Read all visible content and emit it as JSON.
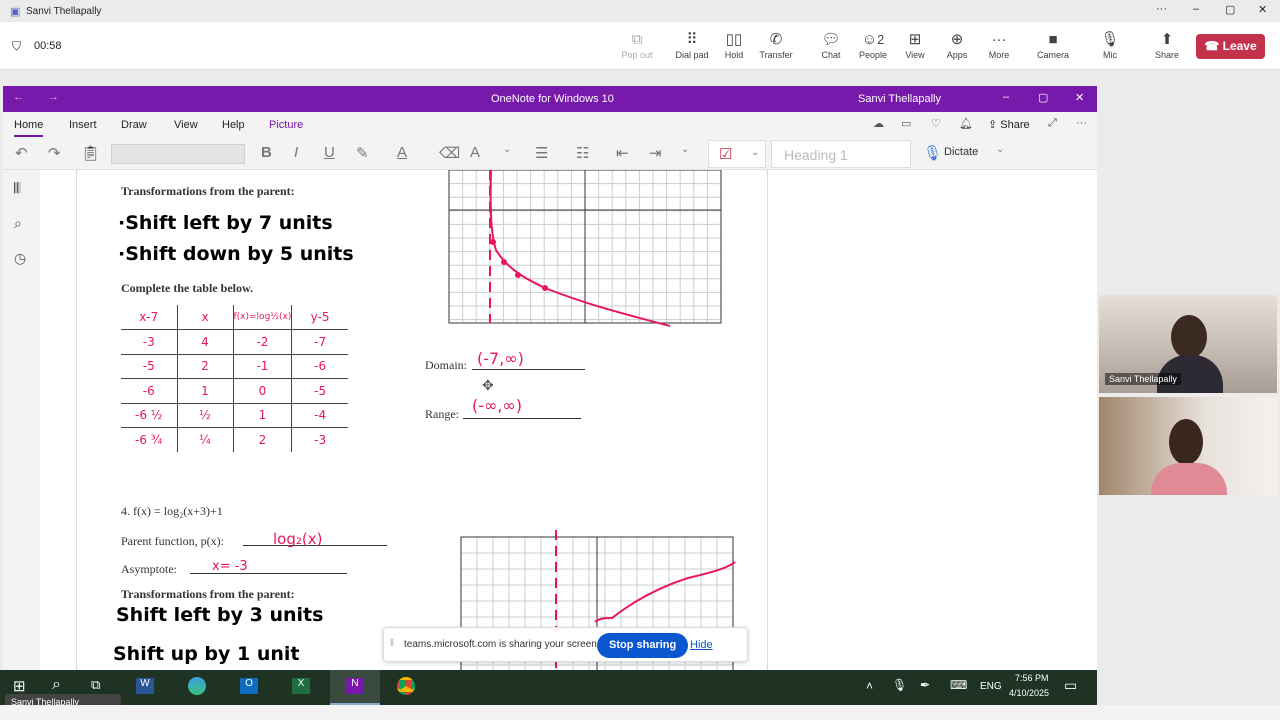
{
  "teams": {
    "app_title": "Sanvi Thellapally",
    "timer": "00:58",
    "buttons": [
      {
        "label": "Pop out",
        "icon": "pop-out-icon"
      },
      {
        "label": "Dial pad",
        "icon": "dial-pad-icon"
      },
      {
        "label": "Hold",
        "icon": "hold-icon"
      },
      {
        "label": "Transfer",
        "icon": "transfer-icon"
      },
      {
        "label": "Chat",
        "icon": "chat-icon"
      },
      {
        "label": "People",
        "icon": "people-icon",
        "badge": "2"
      },
      {
        "label": "View",
        "icon": "view-icon"
      },
      {
        "label": "Apps",
        "icon": "apps-icon"
      },
      {
        "label": "More",
        "icon": "more-icon"
      },
      {
        "label": "Camera",
        "icon": "camera-icon"
      },
      {
        "label": "Mic",
        "icon": "mic-icon"
      },
      {
        "label": "Share",
        "icon": "share-icon"
      }
    ],
    "leave": "Leave",
    "leave_color": "#c4314b",
    "participants": [
      {
        "name": "Sanvi Thellapally"
      },
      {
        "name": ""
      }
    ]
  },
  "onenote": {
    "title": "OneNote for Windows 10",
    "user": "Sanvi Thellapally",
    "accent": "#7719aa",
    "tabs": [
      "Home",
      "Insert",
      "Draw",
      "View",
      "Help",
      "Picture"
    ],
    "active_tab": "Home",
    "share": "Share",
    "style": "Heading 1",
    "dictate": "Dictate"
  },
  "page": {
    "transform_heading": "Transformations from the parent:",
    "p3_transforms": [
      "·Shift left by 7 units",
      "·Shift down by 5 units"
    ],
    "table_heading": "Complete the table below.",
    "table_headers": [
      "x-7",
      "x",
      "f(x)=log½(x)",
      "y-5"
    ],
    "table_rows": [
      [
        "-3",
        "4",
        "-2",
        "-7"
      ],
      [
        "-5",
        "2",
        "-1",
        "-6"
      ],
      [
        "-6",
        "1",
        "0",
        "-5"
      ],
      [
        "-6 ½",
        "½",
        "1",
        "-4"
      ],
      [
        "-6 ¾",
        "¼",
        "2",
        "-3"
      ]
    ],
    "domain_label": "Domain:",
    "domain_value": "(-7,∞)",
    "range_label": "Range:",
    "range_value": "(-∞,∞)",
    "p4_title": "4.  f(x) = log₂(x+3)+1",
    "parent_label": "Parent function, p(x):",
    "parent_value": "log₂(x)",
    "asymptote_label": "Asymptote:",
    "asymptote_value": "x= -3",
    "p4_transforms": [
      "Shift left by 3 units",
      "Shift up by 1 unit"
    ]
  },
  "share_bar": {
    "text": "teams.microsoft.com is sharing your screen.",
    "stop": "Stop sharing",
    "hide": "Hide"
  },
  "taskbar": {
    "apps": [
      "Start",
      "Search",
      "Task View",
      "Word",
      "Edge",
      "Outlook",
      "Excel",
      "OneNote",
      "Chrome"
    ],
    "lang": "ENG",
    "time": "7:56 PM",
    "date": "4/10/2025",
    "tooltip": "Sanvi Thellapally"
  }
}
